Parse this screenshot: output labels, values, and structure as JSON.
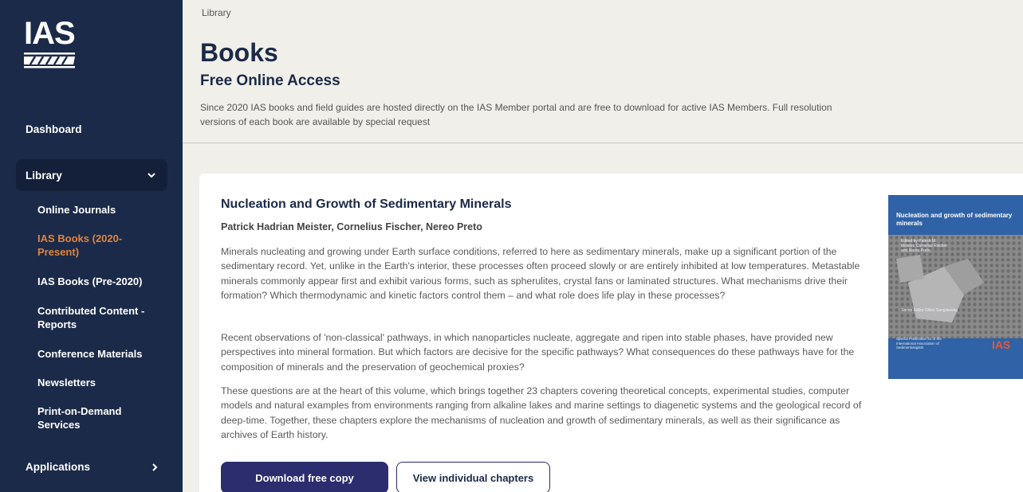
{
  "sidebar": {
    "logo_text": "IAS",
    "dashboard": "Dashboard",
    "library": "Library",
    "items": [
      {
        "label": "Online Journals"
      },
      {
        "label": "IAS Books (2020-Present)"
      },
      {
        "label": "IAS Books (Pre-2020)"
      },
      {
        "label": "Contributed Content - Reports"
      },
      {
        "label": "Conference Materials"
      },
      {
        "label": "Newsletters"
      },
      {
        "label": "Print-on-Demand Services"
      }
    ],
    "applications": "Applications",
    "active_color": "#e0843c"
  },
  "main": {
    "breadcrumb": "Library",
    "title": "Books",
    "subtitle": "Free Online Access",
    "intro": "Since 2020 IAS books and field guides are hosted directly on the IAS Member portal and are free to download for active IAS Members. Full resolution versions of each book are available by special request"
  },
  "book": {
    "title": "Nucleation and Growth of Sedimentary Minerals",
    "authors": "Patrick Hadrian Meister, Cornelius Fischer, Nereo Preto",
    "paragraphs": [
      "Minerals nucleating and growing under Earth surface conditions, referred to here as sedimentary minerals, make up a significant portion of the sedimentary record. Yet, unlike in the Earth's interior, these processes often proceed slowly or are entirely inhibited at low temperatures. Metastable minerals commonly appear first and exhibit various forms, such as spherulites, crystal fans or laminated structures. What mechanisms drive their formation? Which thermodynamic and kinetic factors control them – and what role does life play in these processes?",
      "Recent observations of 'non-classical' pathways, in which nanoparticles nucleate, aggregate and ripen into stable phases, have provided new perspectives into mineral formation. But which factors are decisive for the specific pathways? What consequences do these pathways have for the composition of minerals and the preservation of geochemical proxies?",
      "These questions are at the heart of this volume, which brings together 23 chapters covering theoretical concepts, experimental studies, computer models and natural examples from environments ranging from alkaline lakes and marine settings to diagenetic systems and the geological record of deep-time. Together, these chapters explore the mechanisms of nucleation and growth of sedimentary minerals, as well as their significance as archives of Earth history."
    ],
    "download_label": "Download free copy",
    "chapters_label": "View individual chapters",
    "cover": {
      "title": "Nucleation and growth of sedimentary minerals",
      "editors": "Edited by Patrick M. Meister, Cornelius Fischer and Nereo Preto",
      "series": "Series Editor Gilles Sangiassing",
      "publication": "Special Publication 51 of the International Association of Sedimentologists",
      "logo": "IAS",
      "background": "#2f62a6"
    }
  }
}
